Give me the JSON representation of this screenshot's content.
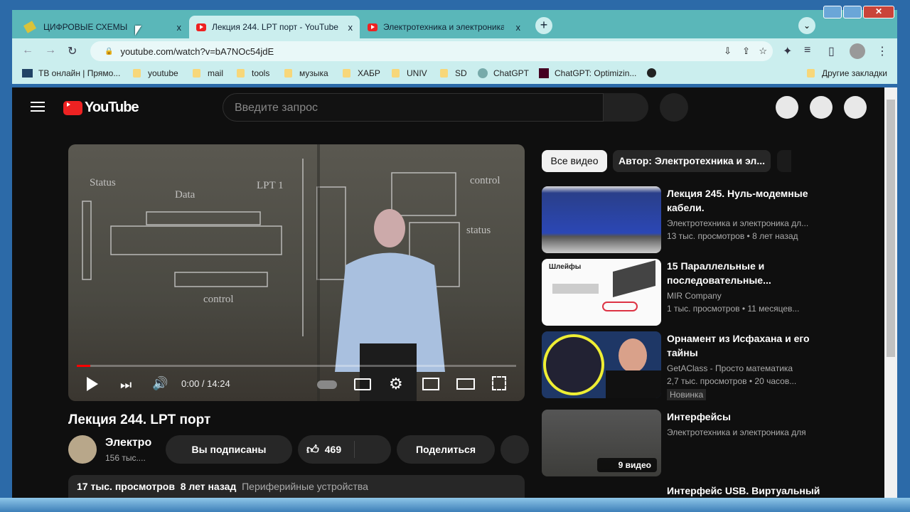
{
  "browser": {
    "tabs": [
      {
        "label": "ЦИФРОВЫЕ СХЕМЫ",
        "close": "x"
      },
      {
        "label": "Лекция 244. LPT порт - YouTube",
        "close": "x"
      },
      {
        "label": "Электротехника и электроника",
        "close": "x"
      }
    ],
    "new_tab": "+",
    "url": "youtube.com/watch?v=bA7NOc54jdE",
    "bookmarks": [
      "ТВ онлайн | Прямо...",
      "youtube",
      "mail",
      "tools",
      "музыка",
      "ХАБР",
      "UNIV",
      "SD",
      "ChatGPT",
      "ChatGPT: Optimizin..."
    ],
    "other_bookmarks": "Другие закладки"
  },
  "youtube": {
    "logo": "YouTube",
    "search_placeholder": "Введите запрос",
    "video": {
      "time": "0:00 / 14:24",
      "progress": 0,
      "title": "Лекция 244. LPT порт",
      "channel": "Электро",
      "subscribers": "156 тыс....",
      "subscribed": "Вы подписаны",
      "likes": "469",
      "share": "Поделиться",
      "views": "17 тыс. просмотров",
      "age": "8 лет назад",
      "playlist": "Периферийные устройства"
    },
    "chips": [
      "Все видео",
      "Автор: Электротехника и эл..."
    ],
    "recommendations": [
      {
        "title": "Лекция 245. Нуль-модемные кабели.",
        "channel": "Электротехника и электроника дл...",
        "stats": "13 тыс. просмотров • 8 лет назад"
      },
      {
        "title": "15 Параллельные и последовательные...",
        "channel": "MIR Company",
        "stats": "1 тыс. просмотров • 11 месяцев...",
        "thumb_text": "Шлейфы"
      },
      {
        "title": "Орнамент из Исфахана и его тайны",
        "channel": "GetAClass - Просто математика",
        "stats": "2,7 тыс. просмотров • 20 часов...",
        "badge": "Новинка"
      },
      {
        "title": "Интерфейсы",
        "channel": "Электротехника и электроника для",
        "overlay": "9 видео"
      },
      {
        "title": "Интерфейс USB. Виртуальный"
      }
    ]
  }
}
